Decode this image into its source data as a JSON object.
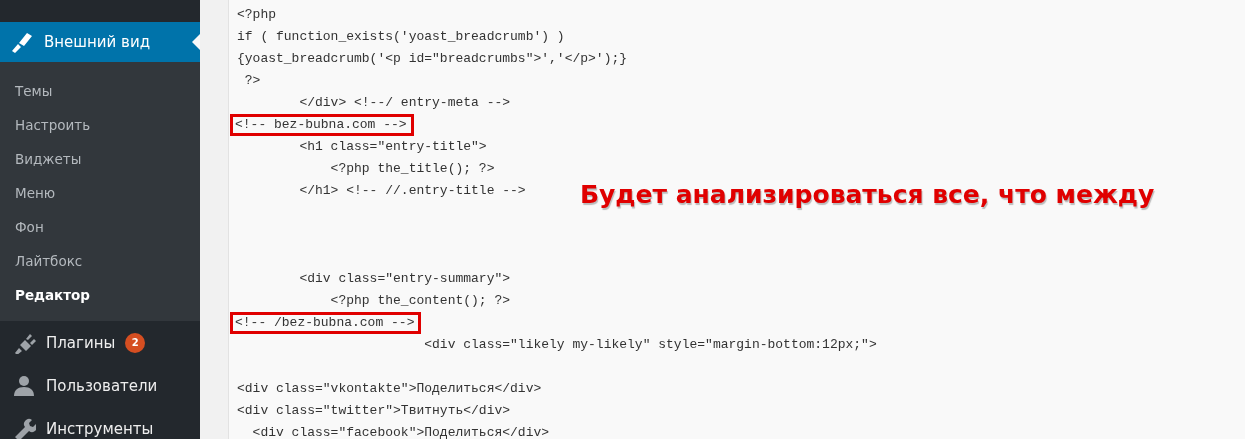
{
  "sidebar": {
    "section": {
      "label": "Внешний вид",
      "selected": true
    },
    "submenu": [
      {
        "label": "Темы",
        "selected": false
      },
      {
        "label": "Настроить",
        "selected": false
      },
      {
        "label": "Виджеты",
        "selected": false
      },
      {
        "label": "Меню",
        "selected": false
      },
      {
        "label": "Фон",
        "selected": false
      },
      {
        "label": "Лайтбокс",
        "selected": false
      },
      {
        "label": "Редактор",
        "selected": true
      }
    ],
    "items": [
      {
        "kind": "plugin",
        "label": "Плагины",
        "badge": "2"
      },
      {
        "kind": "user",
        "label": "Пользователи"
      },
      {
        "kind": "wrench",
        "label": "Инструменты"
      }
    ]
  },
  "editor": {
    "lines": [
      {
        "text": "<?php",
        "boxed": false
      },
      {
        "text": "if ( function_exists('yoast_breadcrumb') )",
        "boxed": false
      },
      {
        "text": "{yoast_breadcrumb('<p id=\"breadcrumbs\">','</p>');}",
        "boxed": false
      },
      {
        "text": " ?>",
        "boxed": false
      },
      {
        "text": "        </div> <!--/ entry-meta -->",
        "boxed": false
      },
      {
        "text": "<!-- bez-bubna.com -->",
        "boxed": true
      },
      {
        "text": "        <h1 class=\"entry-title\">",
        "boxed": false
      },
      {
        "text": "            <?php the_title(); ?>",
        "boxed": false
      },
      {
        "text": "        </h1> <!-- //.entry-title -->",
        "boxed": false
      },
      {
        "boxed": false
      },
      {
        "boxed": false
      },
      {
        "boxed": false
      },
      {
        "text": "        <div class=\"entry-summary\">",
        "boxed": false
      },
      {
        "text": "            <?php the_content(); ?>",
        "boxed": false
      },
      {
        "text": "<!-- /bez-bubna.com -->",
        "boxed": true
      },
      {
        "text": "                        <div class=\"likely my-likely\" style=\"margin-bottom:12px;\">",
        "boxed": false
      },
      {
        "boxed": false
      },
      {
        "text": "<div class=\"vkontakte\">Поделиться</div>",
        "boxed": false
      },
      {
        "text": "<div class=\"twitter\">Твитнуть</div>",
        "boxed": false
      },
      {
        "text": "  <div class=\"facebook\">Поделиться</div>",
        "boxed": false
      }
    ]
  },
  "annotation": "Будет анализироваться все, что между"
}
